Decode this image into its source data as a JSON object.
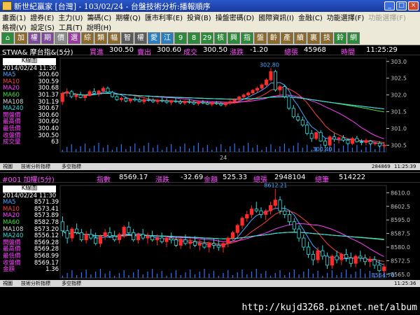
{
  "window": {
    "title": "新世紀贏家 [台灣] - 103/02/24 - 台盤技術分析:播報順序",
    "minimize": "_",
    "maximize": "□",
    "close": "×"
  },
  "menu_row1": [
    {
      "label": "畫面(1)",
      "enabled": true
    },
    {
      "label": "證券(E)",
      "enabled": true
    },
    {
      "label": "主力(U)",
      "enabled": true
    },
    {
      "label": "籌碼(C)",
      "enabled": true
    },
    {
      "label": "期權(Q)",
      "enabled": true
    },
    {
      "label": "匯市利率(E)",
      "enabled": true
    },
    {
      "label": "投資(B)",
      "enabled": true
    },
    {
      "label": "操盤密碼(D)",
      "enabled": true
    },
    {
      "label": "國際資訊(I)",
      "enabled": true
    },
    {
      "label": "金融(C)",
      "enabled": true
    },
    {
      "label": "功能選擇(F)",
      "enabled": true
    },
    {
      "label": "功能選擇(F)",
      "enabled": false
    }
  ],
  "menu_row2": [
    {
      "label": "格視(V)",
      "enabled": true
    },
    {
      "label": "設定(S)",
      "enabled": true
    },
    {
      "label": "工具(T)",
      "enabled": true
    },
    {
      "label": "說明(H)",
      "enabled": true
    }
  ],
  "toolbar": [
    {
      "label": "⌂",
      "bg": "#2b8c3f",
      "icon": "home-icon"
    },
    {
      "label": "加",
      "bg": "#8b6a2e"
    },
    {
      "label": "權",
      "bg": "#7d4a9a"
    },
    {
      "label": "期",
      "bg": "#7d4a9a"
    },
    {
      "label": "價",
      "bg": "#8a8a8a"
    },
    {
      "label": "選",
      "bg": "#9a3aa0"
    },
    {
      "label": "綜",
      "bg": "#8b6a2e"
    },
    {
      "label": "類",
      "bg": "#8b6a2e"
    },
    {
      "label": "幅",
      "bg": "#8b6a2e"
    },
    {
      "label": "智",
      "bg": "#5a5a5a"
    },
    {
      "label": "權",
      "bg": "#5a5a5a"
    },
    {
      "label": "愛",
      "bg": "#2a7fbf"
    },
    {
      "label": "江",
      "bg": "#2a7fbf"
    },
    {
      "label": "9",
      "bg": "#2c8a3a"
    },
    {
      "label": "8",
      "bg": "#2c8a3a"
    },
    {
      "label": "29",
      "bg": "#2c8a3a"
    },
    {
      "label": "核",
      "bg": "#2c8a3a"
    },
    {
      "label": "興",
      "bg": "#2c8a3a"
    },
    {
      "label": "指",
      "bg": "#2c8a3a"
    },
    {
      "label": "盤",
      "bg": "#8b6a2e"
    },
    {
      "label": "齡",
      "bg": "#8b6a2e"
    },
    {
      "label": "產",
      "bg": "#8b6a2e"
    },
    {
      "label": "續",
      "bg": "#8b6a2e"
    },
    {
      "label": "裏",
      "bg": "#8b6a2e"
    },
    {
      "label": "技",
      "bg": "#8b6a2e"
    },
    {
      "label": "鈴",
      "bg": "#2c8a3a"
    },
    {
      "label": "網",
      "bg": "#2c8a3a"
    }
  ],
  "colors": {
    "ma5": "#4da6ff",
    "ma10": "#ff4040",
    "ma20": "#ff40ff",
    "ma60": "#3fe03f",
    "ma108": "#d8d8d8",
    "ma240": "#2fdcdc",
    "bull": "#ff2a2a",
    "bear": "#33e0e0",
    "volume": "#2f72ff",
    "axis": "#c0c0c0"
  },
  "panel1": {
    "info": {
      "symbol": "STWA& 摩台指&(5分)",
      "bid_label": "買進",
      "bid": "300.50",
      "ask_label": "賣出",
      "ask": "300.60",
      "last_label": "成交",
      "last": "300.50",
      "change_label": "漲跌",
      "change": "-1.20",
      "volume_label": "總張",
      "volume": "45968",
      "time_label": "時間",
      "time": "11:25:29"
    },
    "legend": {
      "head": "K線圖",
      "date": "2014/02/24 11:30",
      "rows": [
        {
          "label": "MA5",
          "value": "300.60",
          "color": "#4da6ff"
        },
        {
          "label": "MA10",
          "value": "300.59",
          "color": "#ff4040"
        },
        {
          "label": "MA20",
          "value": "300.68",
          "color": "#ff40ff"
        },
        {
          "label": "MA60",
          "value": "301.37",
          "color": "#3fe03f"
        },
        {
          "label": "MA108",
          "value": "301.19",
          "color": "#d8d8d8"
        },
        {
          "label": "MA240",
          "value": "300.67",
          "color": "#2fdcdc"
        },
        {
          "label": "開盤價",
          "value": "300.60",
          "color": "#ff40ff"
        },
        {
          "label": "最高價",
          "value": "300.60",
          "color": "#ff40ff"
        },
        {
          "label": "最低價",
          "value": "300.40",
          "color": "#ff40ff"
        },
        {
          "label": "收盤價",
          "value": "300.50",
          "color": "#ff40ff"
        },
        {
          "label": "成交量",
          "value": "63",
          "color": "#ff40ff"
        }
      ]
    },
    "strip": {
      "left": "視圖",
      "mid": "技術分析指標",
      "mid2": "多空指標",
      "right1": "284869",
      "right2": "11:25:39"
    }
  },
  "panel2": {
    "info": {
      "symbol": "#001 加權(5分)",
      "index_label": "指數",
      "index": "8569.17",
      "change_label": "漲跌",
      "change": "-32.69",
      "amount_label": "金額",
      "amount": "525.33",
      "volume_label": "總張",
      "volume": "2948104",
      "count_label": "總筆",
      "count": "514222"
    },
    "legend": {
      "head": "K線圖",
      "date": "2014/02/24 11:30",
      "rows": [
        {
          "label": "MA5",
          "value": "8571.39",
          "color": "#4da6ff"
        },
        {
          "label": "MA10",
          "value": "8573.41",
          "color": "#ff4040"
        },
        {
          "label": "MA20",
          "value": "8573.89",
          "color": "#ff40ff"
        },
        {
          "label": "MA60",
          "value": "8582.78",
          "color": "#3fe03f"
        },
        {
          "label": "MA108",
          "value": "8573.20",
          "color": "#d8d8d8"
        },
        {
          "label": "MA240",
          "value": "8556.12",
          "color": "#2fdcdc"
        },
        {
          "label": "開盤價",
          "value": "8569.28",
          "color": "#ff40ff"
        },
        {
          "label": "最高價",
          "value": "8569.28",
          "color": "#ff40ff"
        },
        {
          "label": "最低價",
          "value": "8568.99",
          "color": "#ff40ff"
        },
        {
          "label": "收盤價",
          "value": "8569.17",
          "color": "#ff40ff"
        },
        {
          "label": "金額",
          "value": "1.36",
          "color": "#ff40ff"
        }
      ]
    },
    "strip": {
      "left": "視圖",
      "mid": "技術分析指標",
      "mid2": "多空指標",
      "right1": "",
      "right2": "11:25:36"
    }
  },
  "footer": {
    "url": "http://kujd3268.pixnet.net/album"
  },
  "chart_data": [
    {
      "type": "candlestick",
      "title": "STWA& 摩台指&(5分)",
      "x_tick_labels": [
        "24"
      ],
      "y_ticks": [
        300.5,
        301.0,
        301.5,
        302.0,
        302.5,
        303.0
      ],
      "ylim": [
        300.3,
        303.1
      ],
      "annotations": [
        {
          "text": "302.80",
          "value": 302.8
        },
        {
          "text": "300.40",
          "value": 300.4
        }
      ],
      "candles": [
        [
          301.8,
          302.1,
          301.7,
          302.05
        ],
        [
          302.05,
          302.2,
          301.95,
          302.1
        ],
        [
          302.1,
          302.15,
          301.9,
          301.95
        ],
        [
          301.95,
          302.05,
          301.85,
          302.0
        ],
        [
          302.0,
          302.1,
          301.9,
          301.92
        ],
        [
          301.92,
          302.0,
          301.82,
          301.98
        ],
        [
          301.98,
          302.15,
          301.95,
          302.1
        ],
        [
          302.1,
          302.2,
          302.0,
          302.05
        ],
        [
          302.05,
          302.15,
          301.95,
          302.12
        ],
        [
          302.12,
          302.25,
          302.05,
          302.2
        ],
        [
          302.2,
          302.25,
          302.05,
          302.08
        ],
        [
          302.08,
          302.12,
          301.92,
          301.95
        ],
        [
          301.95,
          302.0,
          301.82,
          301.86
        ],
        [
          301.86,
          301.95,
          301.8,
          301.9
        ],
        [
          301.9,
          301.95,
          301.78,
          301.82
        ],
        [
          301.82,
          301.9,
          301.75,
          301.88
        ],
        [
          301.88,
          301.95,
          301.8,
          301.85
        ],
        [
          301.85,
          301.92,
          301.78,
          301.8
        ],
        [
          301.8,
          301.9,
          301.72,
          301.86
        ],
        [
          301.86,
          301.95,
          301.8,
          301.84
        ],
        [
          301.84,
          301.9,
          301.76,
          301.8
        ],
        [
          301.8,
          301.88,
          301.72,
          301.84
        ],
        [
          301.84,
          301.92,
          301.78,
          301.82
        ],
        [
          301.82,
          301.9,
          301.74,
          301.78
        ],
        [
          301.78,
          301.85,
          301.7,
          301.82
        ],
        [
          301.82,
          301.9,
          301.76,
          301.8
        ],
        [
          301.8,
          301.86,
          301.72,
          301.76
        ],
        [
          301.76,
          301.84,
          301.7,
          301.8
        ],
        [
          301.8,
          301.88,
          301.74,
          301.78
        ],
        [
          301.78,
          301.84,
          301.7,
          301.74
        ],
        [
          301.74,
          301.82,
          301.68,
          301.78
        ],
        [
          301.78,
          301.85,
          301.72,
          301.76
        ],
        [
          301.76,
          301.82,
          301.7,
          301.72
        ],
        [
          301.72,
          301.8,
          301.66,
          301.76
        ],
        [
          301.76,
          301.82,
          301.7,
          301.74
        ],
        [
          301.74,
          301.8,
          301.66,
          301.7
        ],
        [
          301.7,
          301.8,
          301.64,
          301.76
        ],
        [
          301.76,
          301.85,
          301.7,
          301.8
        ],
        [
          301.8,
          301.9,
          301.74,
          301.86
        ],
        [
          301.86,
          301.98,
          301.8,
          301.94
        ],
        [
          301.94,
          302.05,
          301.88,
          302.0
        ],
        [
          302.0,
          302.1,
          301.95,
          302.06
        ],
        [
          302.06,
          302.18,
          302.0,
          302.14
        ],
        [
          302.14,
          302.25,
          302.08,
          302.2
        ],
        [
          302.2,
          302.35,
          302.15,
          302.3
        ],
        [
          302.3,
          302.5,
          302.25,
          302.45
        ],
        [
          302.45,
          302.8,
          302.4,
          302.7
        ],
        [
          302.7,
          302.75,
          302.1,
          302.15
        ],
        [
          302.15,
          302.3,
          302.0,
          302.25
        ],
        [
          302.25,
          302.3,
          301.9,
          301.95
        ],
        [
          301.95,
          302.0,
          301.55,
          301.6
        ],
        [
          301.6,
          301.7,
          301.3,
          301.35
        ],
        [
          301.35,
          301.45,
          301.2,
          301.25
        ],
        [
          301.25,
          301.35,
          301.05,
          301.1
        ],
        [
          301.1,
          301.2,
          300.8,
          300.85
        ],
        [
          300.85,
          300.95,
          300.6,
          300.7
        ],
        [
          300.7,
          300.9,
          300.65,
          300.88
        ],
        [
          300.88,
          300.95,
          300.6,
          300.62
        ],
        [
          300.62,
          300.7,
          300.4,
          300.5
        ],
        [
          300.5,
          300.8,
          300.45,
          300.75
        ],
        [
          300.75,
          300.85,
          300.6,
          300.68
        ],
        [
          300.68,
          300.75,
          300.55,
          300.72
        ],
        [
          300.72,
          300.8,
          300.6,
          300.65
        ],
        [
          300.65,
          300.7,
          300.5,
          300.55
        ],
        [
          300.55,
          300.75,
          300.5,
          300.7
        ],
        [
          300.7,
          300.78,
          300.58,
          300.6
        ],
        [
          300.6,
          300.68,
          300.5,
          300.58
        ],
        [
          300.58,
          300.7,
          300.5,
          300.62
        ],
        [
          300.62,
          300.66,
          300.5,
          300.54
        ],
        [
          300.54,
          300.6,
          300.48,
          300.56
        ],
        [
          300.56,
          300.62,
          300.44,
          300.48
        ],
        [
          300.48,
          300.6,
          300.4,
          300.5
        ]
      ]
    },
    {
      "type": "candlestick",
      "title": "#001 加權(5分)",
      "x_tick_labels": [
        "24"
      ],
      "y_ticks": [
        8565.0,
        8572.5,
        8580.0,
        8587.5,
        8595.0,
        8602.5,
        8610.0
      ],
      "ylim": [
        8563.0,
        8614.0
      ],
      "annotations": [
        {
          "text": "8612.21",
          "value": 8612.21
        },
        {
          "text": "8564.70",
          "value": 8564.7
        }
      ],
      "candles": [
        [
          8594,
          8597,
          8586,
          8589
        ],
        [
          8589,
          8592,
          8582,
          8585
        ],
        [
          8585,
          8591,
          8583,
          8590
        ],
        [
          8590,
          8593,
          8587,
          8588
        ],
        [
          8588,
          8590,
          8583,
          8584
        ],
        [
          8584,
          8589,
          8582,
          8587
        ],
        [
          8587,
          8590,
          8584,
          8585
        ],
        [
          8585,
          8588,
          8581,
          8582
        ],
        [
          8582,
          8587,
          8580,
          8586
        ],
        [
          8586,
          8590,
          8584,
          8588
        ],
        [
          8588,
          8591,
          8585,
          8586
        ],
        [
          8586,
          8589,
          8583,
          8584
        ],
        [
          8584,
          8588,
          8582,
          8587
        ],
        [
          8587,
          8592,
          8585,
          8591
        ],
        [
          8591,
          8594,
          8587,
          8588
        ],
        [
          8588,
          8590,
          8583,
          8584
        ],
        [
          8584,
          8588,
          8582,
          8587
        ],
        [
          8587,
          8590,
          8584,
          8585
        ],
        [
          8585,
          8588,
          8582,
          8586
        ],
        [
          8586,
          8589,
          8583,
          8584
        ],
        [
          8584,
          8587,
          8581,
          8585
        ],
        [
          8585,
          8588,
          8582,
          8583
        ],
        [
          8583,
          8586,
          8580,
          8585
        ],
        [
          8585,
          8588,
          8582,
          8584
        ],
        [
          8584,
          8586,
          8580,
          8581
        ],
        [
          8581,
          8585,
          8579,
          8584
        ],
        [
          8584,
          8587,
          8581,
          8582
        ],
        [
          8582,
          8585,
          8579,
          8583
        ],
        [
          8583,
          8586,
          8580,
          8581
        ],
        [
          8581,
          8584,
          8578,
          8582
        ],
        [
          8582,
          8585,
          8579,
          8580
        ],
        [
          8580,
          8583,
          8577,
          8582
        ],
        [
          8582,
          8585,
          8579,
          8581
        ],
        [
          8581,
          8584,
          8578,
          8580
        ],
        [
          8580,
          8583,
          8577,
          8582
        ],
        [
          8582,
          8586,
          8580,
          8585
        ],
        [
          8585,
          8589,
          8583,
          8588
        ],
        [
          8588,
          8593,
          8586,
          8592
        ],
        [
          8592,
          8597,
          8590,
          8596
        ],
        [
          8596,
          8600,
          8594,
          8598
        ],
        [
          8598,
          8603,
          8596,
          8601
        ],
        [
          8601,
          8605,
          8599,
          8600
        ],
        [
          8600,
          8602,
          8596,
          8598
        ],
        [
          8598,
          8601,
          8595,
          8600
        ],
        [
          8600,
          8605,
          8598,
          8603
        ],
        [
          8603,
          8612.21,
          8601,
          8606
        ],
        [
          8606,
          8608,
          8598,
          8600
        ],
        [
          8600,
          8603,
          8596,
          8598
        ],
        [
          8598,
          8600,
          8592,
          8594
        ],
        [
          8594,
          8596,
          8588,
          8590
        ],
        [
          8590,
          8592,
          8583,
          8585
        ],
        [
          8585,
          8587,
          8578,
          8580
        ],
        [
          8580,
          8583,
          8574,
          8576
        ],
        [
          8576,
          8578,
          8570,
          8573
        ],
        [
          8573,
          8580,
          8571,
          8578
        ],
        [
          8578,
          8581,
          8573,
          8575
        ],
        [
          8575,
          8577,
          8568,
          8570
        ],
        [
          8570,
          8576,
          8568,
          8575
        ],
        [
          8575,
          8578,
          8571,
          8573
        ],
        [
          8573,
          8577,
          8570,
          8576
        ],
        [
          8576,
          8579,
          8572,
          8574
        ],
        [
          8574,
          8577,
          8569,
          8571
        ],
        [
          8571,
          8576,
          8569,
          8575
        ],
        [
          8575,
          8578,
          8572,
          8574
        ],
        [
          8574,
          8576,
          8570,
          8572
        ],
        [
          8572,
          8575,
          8569,
          8573
        ],
        [
          8573,
          8575,
          8568,
          8570
        ],
        [
          8570,
          8573,
          8566,
          8567
        ],
        [
          8567,
          8571,
          8564.7,
          8569.17
        ]
      ]
    }
  ]
}
